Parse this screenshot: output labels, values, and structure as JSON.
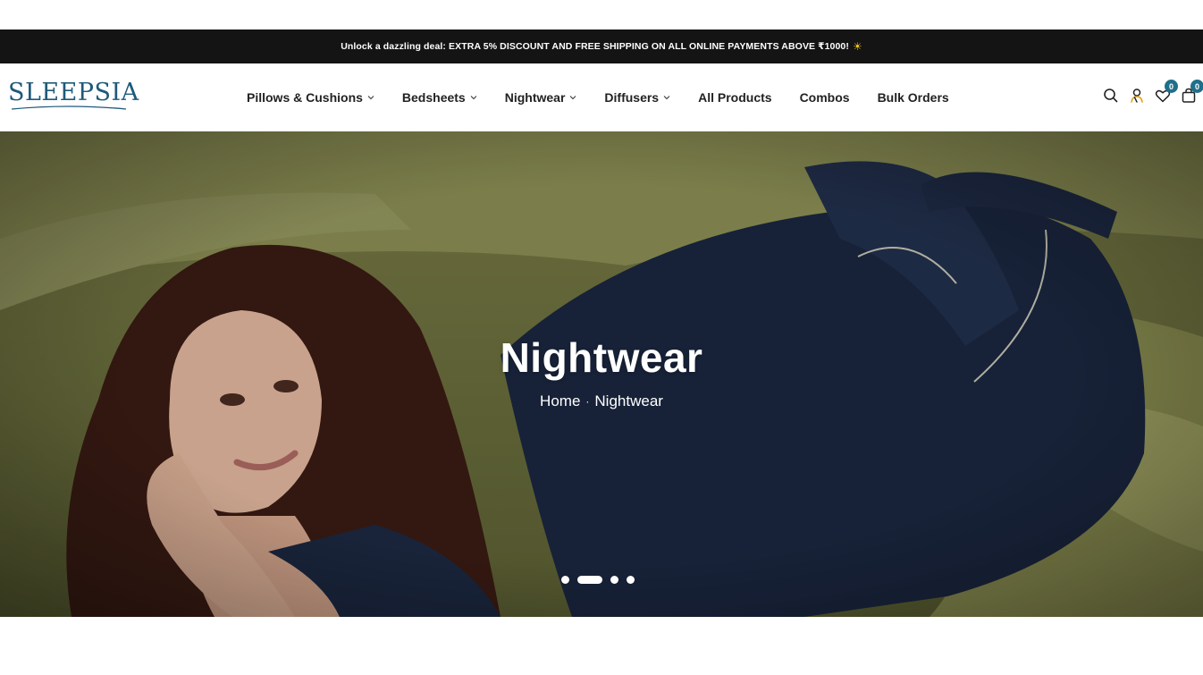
{
  "announcement": {
    "text": "Unlock a dazzling deal: EXTRA 5% DISCOUNT AND FREE SHIPPING ON ALL ONLINE PAYMENTS ABOVE ₹1000!",
    "emoji": "☀"
  },
  "brand": {
    "logo_text": "SLEEPSIA",
    "color": "#1f5a7a"
  },
  "nav": {
    "items": [
      {
        "label": "Pillows & Cushions",
        "has_dropdown": true
      },
      {
        "label": "Bedsheets",
        "has_dropdown": true
      },
      {
        "label": "Nightwear",
        "has_dropdown": true
      },
      {
        "label": "Diffusers",
        "has_dropdown": true
      },
      {
        "label": "All Products",
        "has_dropdown": false
      },
      {
        "label": "Combos",
        "has_dropdown": false
      },
      {
        "label": "Bulk Orders",
        "has_dropdown": false
      }
    ]
  },
  "header_icons": {
    "search": "search-icon",
    "account": "user-icon",
    "wishlist": {
      "icon": "heart-icon",
      "count": "0"
    },
    "cart": {
      "icon": "bag-icon",
      "count": "0"
    },
    "badge_color": "#1f6f8b"
  },
  "hero": {
    "title": "Nightwear",
    "breadcrumb": {
      "home": "Home",
      "separator": "·",
      "current": "Nightwear"
    },
    "slides": {
      "count": 4,
      "active_index": 1
    }
  }
}
